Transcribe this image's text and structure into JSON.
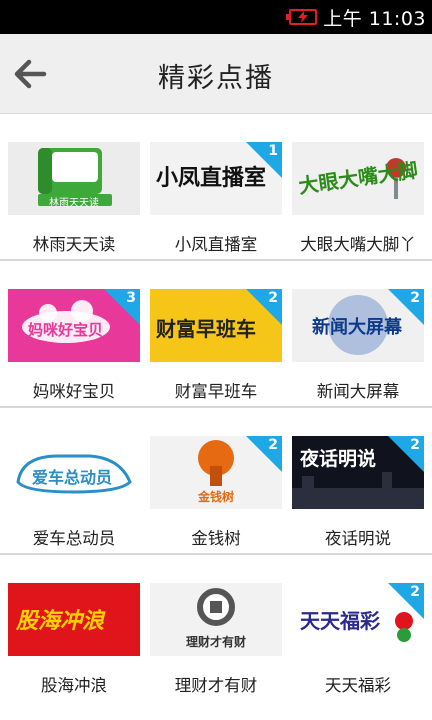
{
  "status_bar": {
    "time": "上午 11:03"
  },
  "header": {
    "title": "精彩点播"
  },
  "rows": [
    [
      {
        "label": "林雨天天读",
        "logo_text": "林雨天天读",
        "badge": ""
      },
      {
        "label": "小凤直播室",
        "logo_text": "小凤直播室",
        "badge": "1"
      },
      {
        "label": "大眼大嘴大脚丫",
        "logo_text": "大眼大嘴大脚",
        "badge": ""
      }
    ],
    [
      {
        "label": "妈咪好宝贝",
        "logo_text": "妈咪好宝贝",
        "badge": "3"
      },
      {
        "label": "财富早班车",
        "logo_text": "财富早班车",
        "badge": "2"
      },
      {
        "label": "新闻大屏幕",
        "logo_text": "新闻大屏幕",
        "badge": "2"
      }
    ],
    [
      {
        "label": "爱车总动员",
        "logo_text": "爱车总动员",
        "badge": ""
      },
      {
        "label": "金钱树",
        "logo_text": "金钱树",
        "badge": "2"
      },
      {
        "label": "夜话明说",
        "logo_text": "夜话明说",
        "badge": "2"
      }
    ],
    [
      {
        "label": "股海冲浪",
        "logo_text": "股海冲浪",
        "badge": ""
      },
      {
        "label": "理财才有财",
        "logo_text": "理财才有财",
        "badge": ""
      },
      {
        "label": "天天福彩",
        "logo_text": "天天福彩",
        "badge": "2"
      }
    ]
  ]
}
